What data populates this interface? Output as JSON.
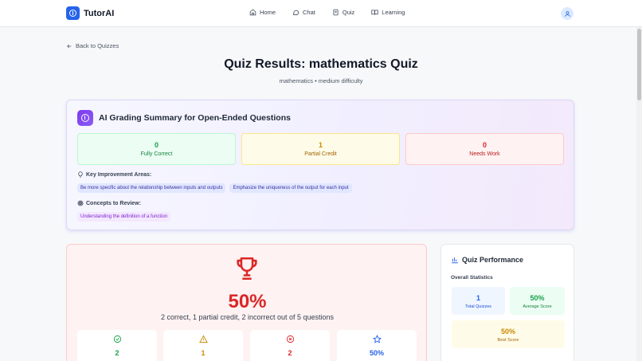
{
  "nav": {
    "brand": "TutorAI",
    "links": [
      {
        "label": "Home",
        "icon": "home-icon"
      },
      {
        "label": "Chat",
        "icon": "chat-icon"
      },
      {
        "label": "Quiz",
        "icon": "quiz-icon"
      },
      {
        "label": "Learning",
        "icon": "book-icon"
      }
    ],
    "avatar_icon": "user-icon"
  },
  "header": {
    "back_label": "Back to Quizzes",
    "title": "Quiz Results: mathematics Quiz",
    "subtitle": "mathematics • medium difficulty"
  },
  "ai_summary": {
    "title": "AI Grading Summary for Open-Ended Questions",
    "fully_correct": {
      "value": "0",
      "label": "Fully Correct"
    },
    "partial_credit": {
      "value": "1",
      "label": "Partial Credit"
    },
    "needs_work": {
      "value": "0",
      "label": "Needs Work"
    },
    "improvement_label": "Key Improvement Areas:",
    "improvements": [
      "Be more specific about the relationship between inputs and outputs",
      "Emphasize the uniqueness of the output for each input"
    ],
    "concepts_label": "Concepts to Review:",
    "concepts": [
      "Understanding the definition of a function"
    ]
  },
  "score": {
    "percent": "50%",
    "description": "2 correct, 1 partial credit, 2 incorrect out of 5 questions",
    "mini": [
      {
        "icon": "check-circle-icon",
        "value": "2",
        "color": "#16a34a"
      },
      {
        "icon": "warning-icon",
        "value": "1",
        "color": "#ca8a04"
      },
      {
        "icon": "x-circle-icon",
        "value": "2",
        "color": "#dc2626"
      },
      {
        "icon": "star-icon",
        "value": "50%",
        "color": "#2563eb"
      }
    ]
  },
  "performance": {
    "title": "Quiz Performance",
    "overall_label": "Overall Statistics",
    "total_quizzes": {
      "value": "1",
      "label": "Total Quizzes"
    },
    "average_score": {
      "value": "50%",
      "label": "Average Score"
    },
    "best_score": {
      "value": "50%",
      "label": "Best Score"
    }
  }
}
